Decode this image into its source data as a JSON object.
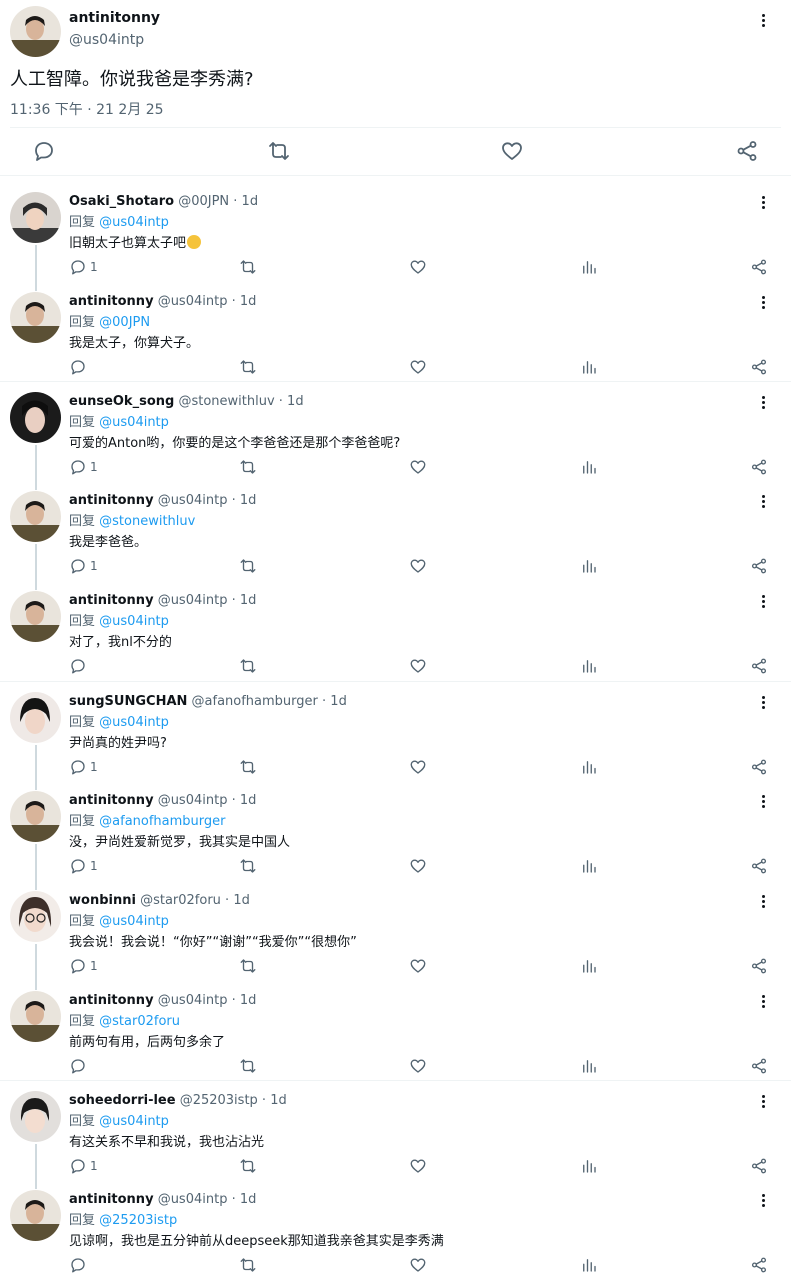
{
  "main_tweet": {
    "name": "antinitonny",
    "handle": "@us04intp",
    "text": "人工智障。你说我爸是李秀满?",
    "timestamp": "11:36 下午 · 21 2月 25"
  },
  "colors": {
    "link": "#1d9bf0",
    "muted": "#536471",
    "line": "#cfd9de"
  },
  "icons": [
    "comment-icon",
    "retweet-icon",
    "like-icon",
    "views-icon",
    "share-icon",
    "more-icon"
  ],
  "replies": [
    {
      "name": "Osaki_Shotaro",
      "handle": "@00JPN",
      "time": "1d",
      "replying_label": "回复",
      "replying_to": "@us04intp",
      "text": "旧朝太子也算太子吧",
      "emoji": "thinking-face",
      "reply_count": "1"
    },
    {
      "name": "antinitonny",
      "handle": "@us04intp",
      "time": "1d",
      "replying_label": "回复",
      "replying_to": "@00JPN",
      "text": "我是太子，你算犬子。",
      "reply_count": ""
    },
    {
      "name": "eunseOk_song",
      "handle": "@stonewithluv",
      "time": "1d",
      "replying_label": "回复",
      "replying_to": "@us04intp",
      "text": "可爱的Anton哟，你要的是这个李爸爸还是那个李爸爸呢?",
      "reply_count": "1"
    },
    {
      "name": "antinitonny",
      "handle": "@us04intp",
      "time": "1d",
      "replying_label": "回复",
      "replying_to": "@stonewithluv",
      "text": "我是李爸爸。",
      "reply_count": "1"
    },
    {
      "name": "antinitonny",
      "handle": "@us04intp",
      "time": "1d",
      "replying_label": "回复",
      "replying_to": "@us04intp",
      "text": "对了，我nl不分的",
      "reply_count": ""
    },
    {
      "name": "sungSUNGCHAN",
      "handle": "@afanofhamburger",
      "time": "1d",
      "replying_label": "回复",
      "replying_to": "@us04intp",
      "text": "尹尚真的姓尹吗?",
      "reply_count": "1"
    },
    {
      "name": "antinitonny",
      "handle": "@us04intp",
      "time": "1d",
      "replying_label": "回复",
      "replying_to": "@afanofhamburger",
      "text": "没，尹尚姓爱新觉罗，我其实是中国人",
      "reply_count": "1"
    },
    {
      "name": "wonbinni",
      "handle": "@star02foru",
      "time": "1d",
      "replying_label": "回复",
      "replying_to": "@us04intp",
      "text": "我会说！我会说！“你好”“谢谢”“我爱你”“很想你”",
      "reply_count": "1"
    },
    {
      "name": "antinitonny",
      "handle": "@us04intp",
      "time": "1d",
      "replying_label": "回复",
      "replying_to": "@star02foru",
      "text": "前两句有用，后两句多余了",
      "reply_count": ""
    },
    {
      "name": "soheedorri-lee",
      "handle": "@25203istp",
      "time": "1d",
      "replying_label": "回复",
      "replying_to": "@us04intp",
      "text": "有这关系不早和我说，我也沾沾光",
      "reply_count": "1"
    },
    {
      "name": "antinitonny",
      "handle": "@us04intp",
      "time": "1d",
      "replying_label": "回复",
      "replying_to": "@25203istp",
      "text": "见谅啊，我也是五分钟前从deepseek那知道我亲爸其实是李秀满",
      "reply_count": ""
    }
  ]
}
